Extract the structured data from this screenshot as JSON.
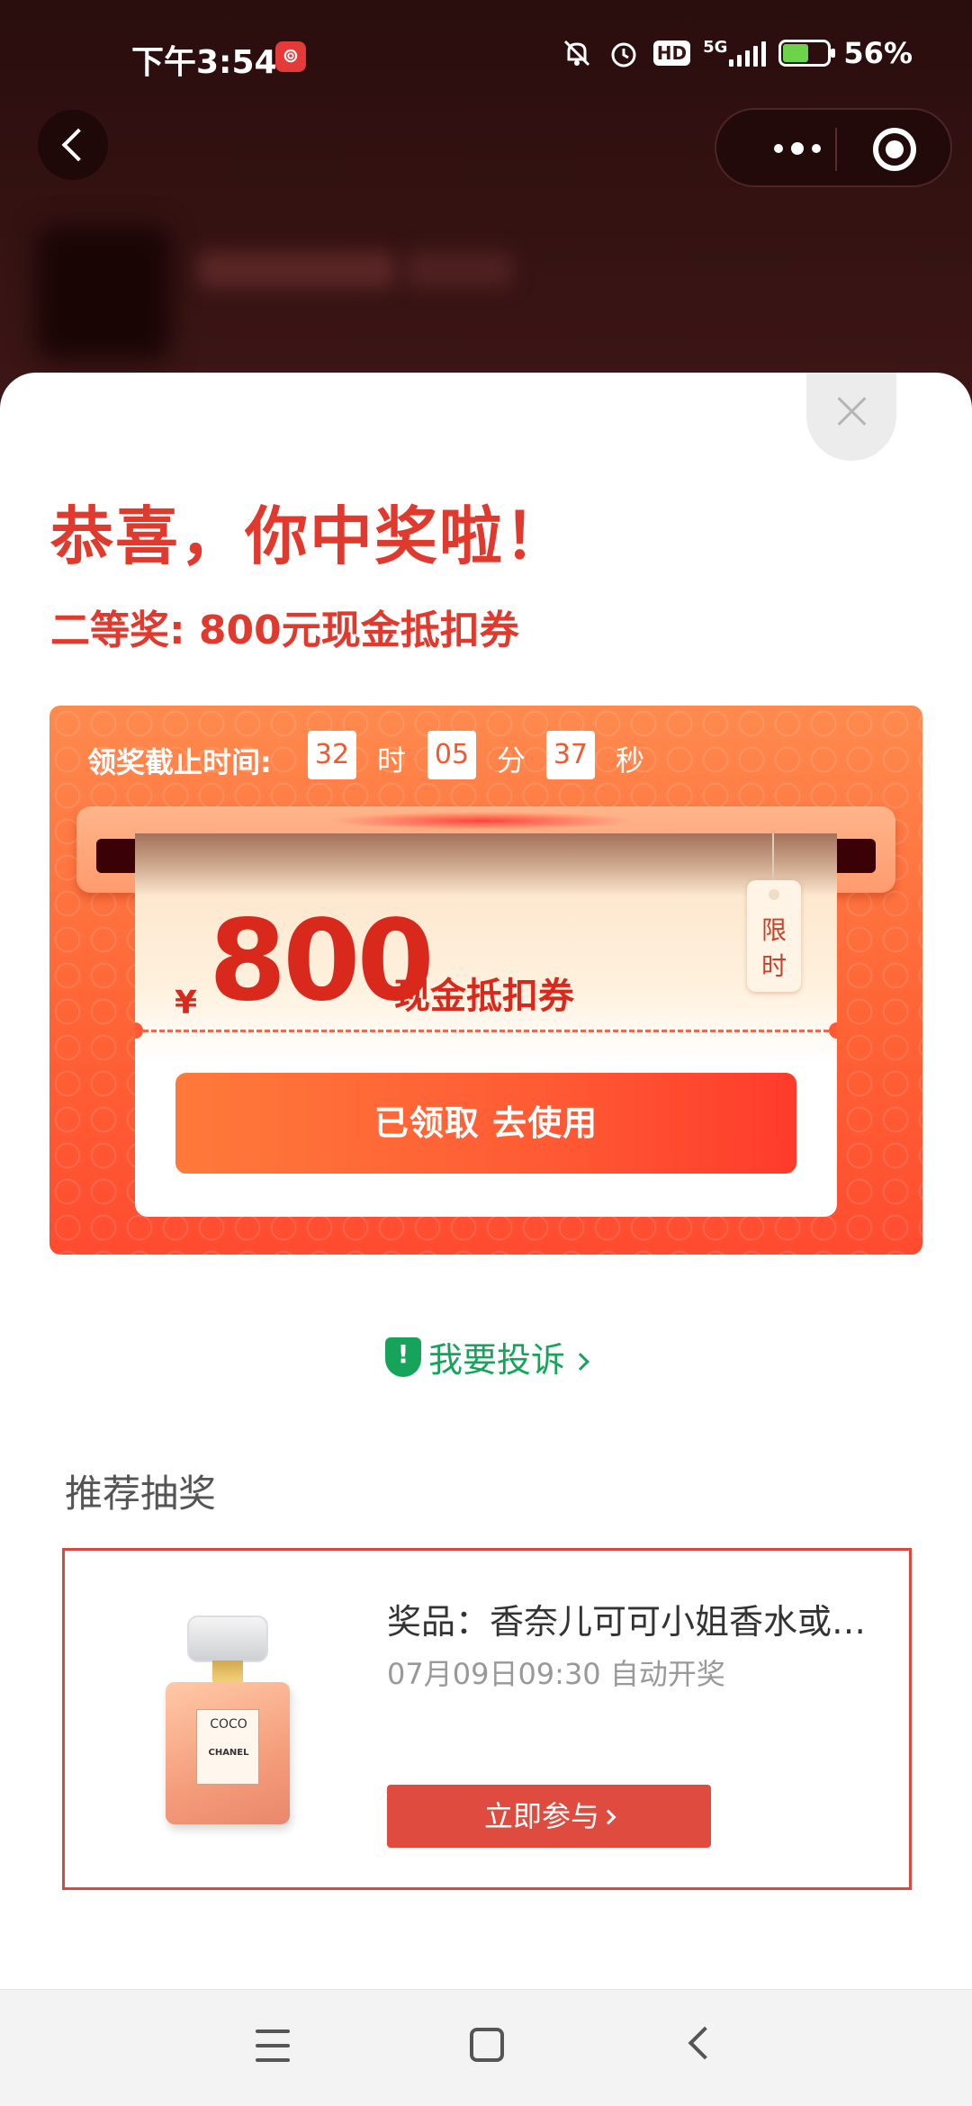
{
  "status_bar": {
    "time": "下午3:54",
    "app_badge": "⊚",
    "network": "5G",
    "hd": "HD",
    "battery": "56%",
    "battery_level": 0.56
  },
  "nav": {
    "back_icon": "chevron-left-icon",
    "more_icon": "more-dots-icon",
    "close_mini_icon": "target-icon"
  },
  "dialog": {
    "title": "恭喜，你中奖啦！",
    "prize": "二等奖: 800元现金抵扣券",
    "deadline": {
      "label": "领奖截止时间:",
      "hours": "32",
      "hours_unit": "时",
      "minutes": "05",
      "minutes_unit": "分",
      "seconds": "37",
      "seconds_unit": "秒"
    },
    "coupon": {
      "currency": "¥",
      "amount": "800",
      "type": "现金抵扣券",
      "tag_line1": "限",
      "tag_line2": "时",
      "button": "已领取 去使用"
    },
    "complain": "我要投诉"
  },
  "recommend": {
    "section_title": "推荐抽奖",
    "item": {
      "name": "奖品：香奈儿可可小姐香水或…",
      "draw_time": "07月09日09:30 自动开奖",
      "button": "立即参与",
      "bottle_label_1": "COCO",
      "bottle_label_2": "CHANEL"
    }
  },
  "colors": {
    "accent_red": "#e0392e",
    "coupon_orange": "#ff6536",
    "complain_green": "#16a35a",
    "dark_header": "#2a0d0d"
  }
}
